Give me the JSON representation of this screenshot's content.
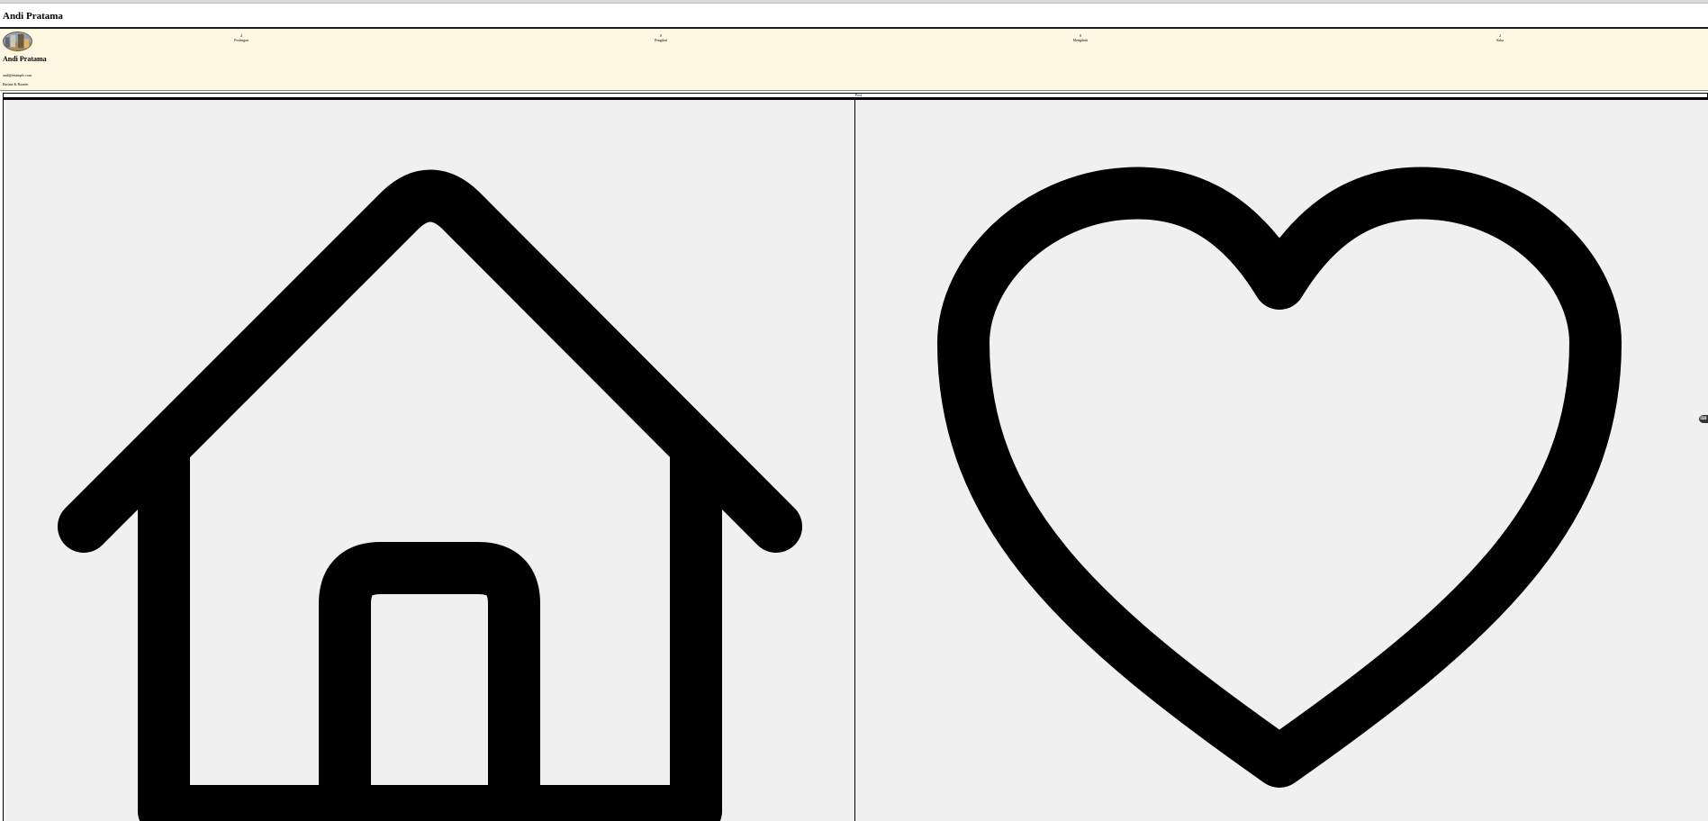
{
  "page": {
    "title": "Andi Pratama"
  },
  "profile": {
    "name": "Andi Pratama",
    "email": "andi@example.com",
    "role": "Barista & Roaster",
    "avatar_icon": "profile-photo"
  },
  "stats": [
    {
      "count": "4",
      "label": "Postingan"
    },
    {
      "count": "0",
      "label": "Pengikut"
    },
    {
      "count": "0",
      "label": "Mengikuti"
    },
    {
      "count": "2",
      "label": "Suka"
    }
  ],
  "tabs": {
    "active_label": "Post"
  },
  "posts": [
    {
      "icon": "home-icon"
    },
    {
      "icon": "heart-icon"
    }
  ],
  "floating": {
    "icon": "chat-icon",
    "glyph": "⌨"
  }
}
